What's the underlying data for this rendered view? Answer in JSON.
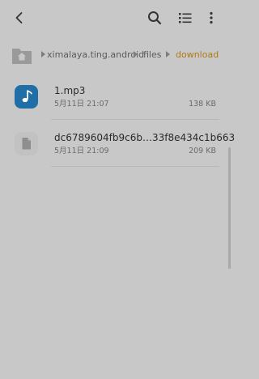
{
  "breadcrumb": {
    "items": [
      {
        "label": "ximalaya.ting.android"
      },
      {
        "label": "files"
      },
      {
        "label": "download"
      }
    ]
  },
  "files": [
    {
      "name": "1.mp3",
      "date": "5月11日 21:07",
      "size": "138 KB",
      "type": "audio"
    },
    {
      "name": "dc6789604fb9c6b…33f8e434c1b663",
      "date": "5月11日 21:09",
      "size": "209 KB",
      "type": "generic"
    }
  ],
  "colors": {
    "background": "#c8c8c8",
    "breadcrumb_active": "#b07a10",
    "audio_icon": "#1f6ea8"
  },
  "icons": {
    "back": "back-arrow-icon",
    "search": "search-icon",
    "list": "list-view-icon",
    "more": "more-vertical-icon",
    "home": "home-folder-icon",
    "audio": "music-note-icon",
    "generic": "document-icon"
  }
}
